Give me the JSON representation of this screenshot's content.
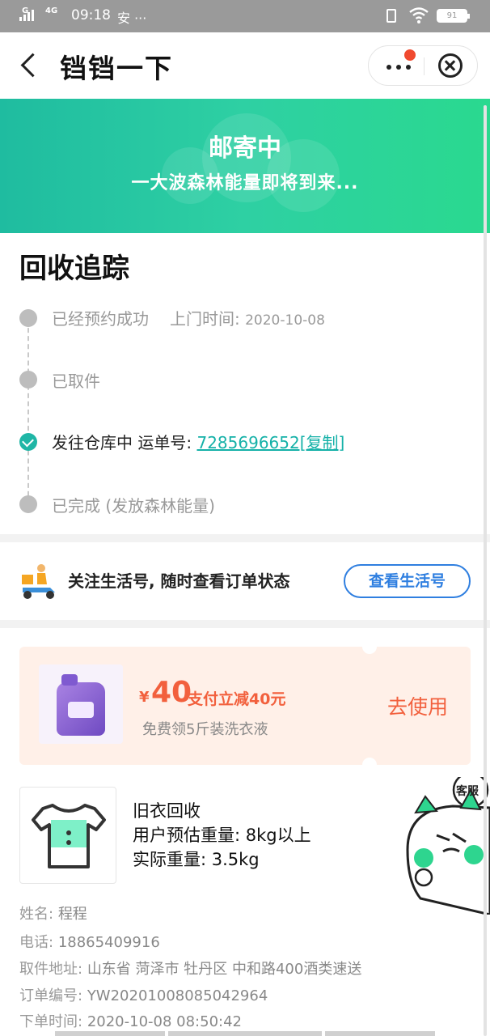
{
  "status_bar": {
    "network_1": "G",
    "network_2": "4G",
    "time": "09:18",
    "extra": "安 ···",
    "battery": "91"
  },
  "nav": {
    "title": "铛铛一下"
  },
  "banner": {
    "title": "邮寄中",
    "subtitle": "一大波森林能量即将到来..."
  },
  "tracking": {
    "title": "回收追踪",
    "steps": [
      {
        "label": "已经预约成功",
        "extra_label": "上门时间:",
        "extra_value": "2020-10-08"
      },
      {
        "label": "已取件"
      },
      {
        "label": "发往仓库中 运单号:",
        "link": "7285696652[复制]"
      },
      {
        "label": "已完成 (发放森林能量)"
      }
    ]
  },
  "follow": {
    "text": "关注生活号, 随时查看订单状态",
    "button": "查看生活号"
  },
  "coupon": {
    "currency": "¥",
    "amount": "40",
    "rule": "支付立减40元",
    "description": "免费领5斤装洗衣液",
    "action": "去使用"
  },
  "item": {
    "name": "旧衣回收",
    "estimated_weight": "用户预估重量: 8kg以上",
    "actual_weight": "实际重量: 3.5kg"
  },
  "order": {
    "name_label": "姓名:",
    "name_value": "程程",
    "phone_label": "电话:",
    "phone_value": "18865409916",
    "address_label": "取件地址:",
    "address_value": "山东省 菏泽市 牡丹区 中和路400酒类速送",
    "order_no_label": "订单编号:",
    "order_no_value": "YW2020100808504​2964",
    "time_label": "下单时间:",
    "time_value": "2020-10-08 08:50:42"
  },
  "service": {
    "label": "客服"
  },
  "colors": {
    "brand_green": "#2ed0a3",
    "link_teal": "#15b1a8",
    "coupon_orange": "#f2603d",
    "button_blue": "#2f7fe0"
  },
  "icons": [
    "back-arrow-icon",
    "more-icon",
    "close-icon",
    "wifi-icon",
    "battery-icon",
    "check-icon",
    "delivery-scooter-icon",
    "tshirt-icon",
    "mascot-icon"
  ]
}
